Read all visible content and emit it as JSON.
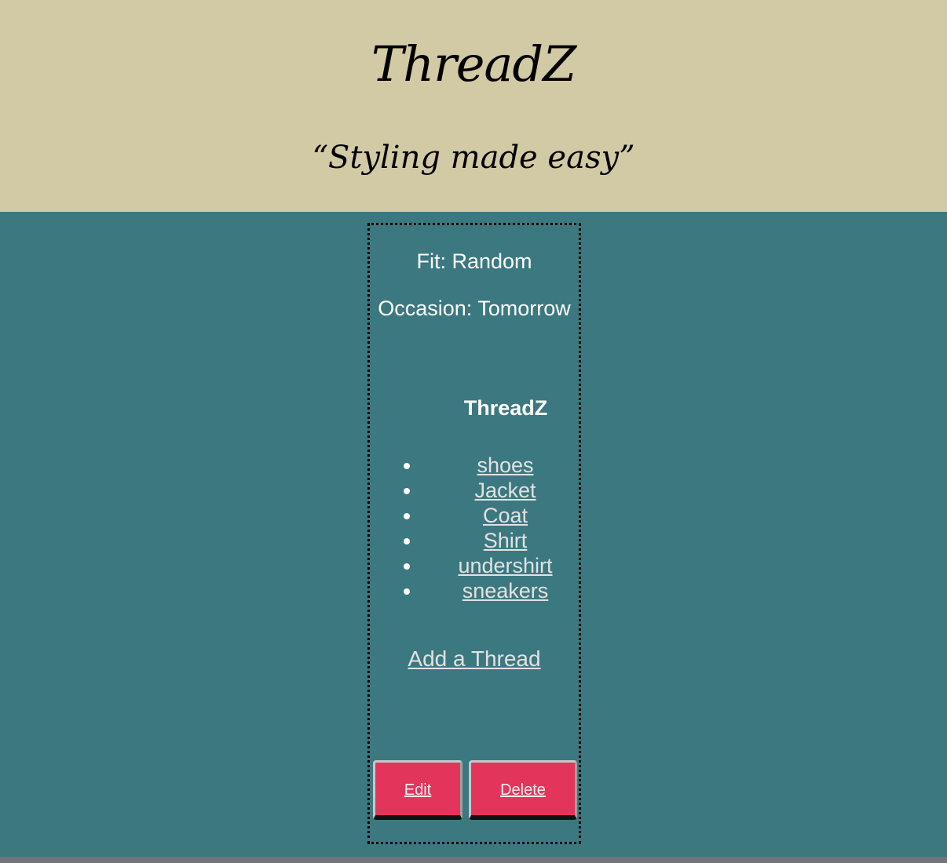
{
  "header": {
    "brand": "ThreadZ",
    "tagline": "“Styling made easy”"
  },
  "card": {
    "fit_text": "Fit: Random",
    "occasion_text": "Occasion: Tomorrow",
    "list_title": "ThreadZ",
    "threads": [
      "shoes",
      "Jacket",
      "Coat",
      "Shirt",
      "undershirt",
      "sneakers"
    ],
    "add_link": "Add a Thread",
    "edit_label": "Edit",
    "delete_label": "Delete"
  },
  "colors": {
    "header_bg": "#d2caa4",
    "page_bg": "#3c7880",
    "button_bg": "#e3355b"
  }
}
